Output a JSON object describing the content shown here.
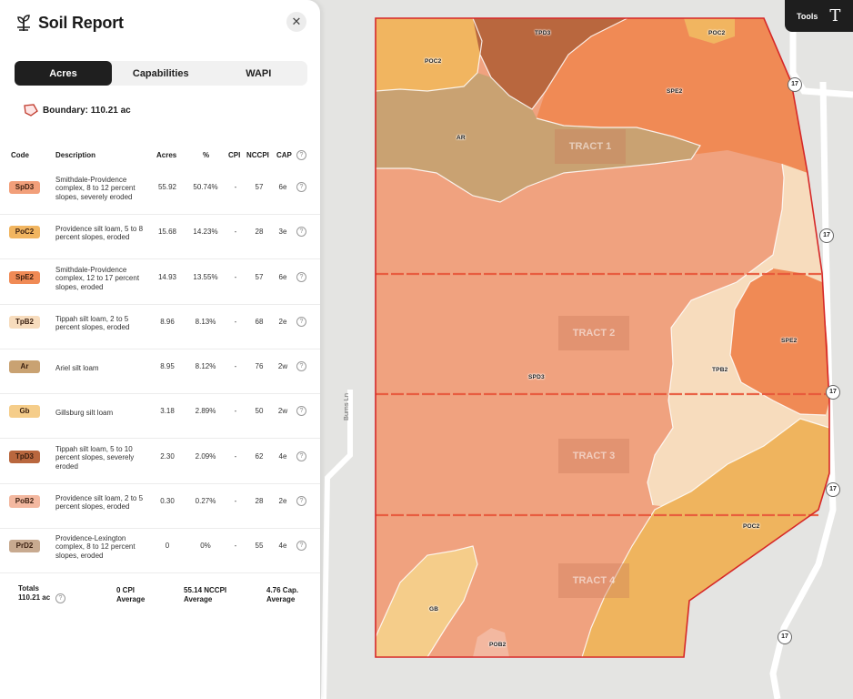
{
  "panel": {
    "title": "Soil Report",
    "close_icon": "close-icon",
    "tabs": [
      {
        "label": "Acres",
        "active": true
      },
      {
        "label": "Capabilities",
        "active": false
      },
      {
        "label": "WAPI",
        "active": false
      }
    ],
    "boundary_label": "Boundary: 110.21 ac"
  },
  "table": {
    "headers": {
      "code": "Code",
      "description": "Description",
      "acres": "Acres",
      "pct": "%",
      "cpi": "CPI",
      "nccpi": "NCCPI",
      "cap": "CAP"
    },
    "rows": [
      {
        "code": "SpD3",
        "color": "#f29f7a",
        "description": "Smithdale-Providence complex, 8 to 12 percent slopes, severely eroded",
        "acres": "55.92",
        "pct": "50.74%",
        "cpi": "-",
        "nccpi": "57",
        "cap": "6e"
      },
      {
        "code": "PoC2",
        "color": "#f1b560",
        "description": "Providence silt loam, 5 to 8 percent slopes, eroded",
        "acres": "15.68",
        "pct": "14.23%",
        "cpi": "-",
        "nccpi": "28",
        "cap": "3e"
      },
      {
        "code": "SpE2",
        "color": "#f08a55",
        "description": "Smithdale-Providence complex, 12 to 17 percent slopes, eroded",
        "acres": "14.93",
        "pct": "13.55%",
        "cpi": "-",
        "nccpi": "57",
        "cap": "6e"
      },
      {
        "code": "TpB2",
        "color": "#f7dcbd",
        "description": "Tippah silt loam, 2 to 5 percent slopes, eroded",
        "acres": "8.96",
        "pct": "8.13%",
        "cpi": "-",
        "nccpi": "68",
        "cap": "2e"
      },
      {
        "code": "Ar",
        "color": "#c9a272",
        "description": "Ariel silt loam",
        "acres": "8.95",
        "pct": "8.12%",
        "cpi": "-",
        "nccpi": "76",
        "cap": "2w"
      },
      {
        "code": "Gb",
        "color": "#f5cd8a",
        "description": "Gillsburg silt loam",
        "acres": "3.18",
        "pct": "2.89%",
        "cpi": "-",
        "nccpi": "50",
        "cap": "2w"
      },
      {
        "code": "TpD3",
        "color": "#b9673e",
        "description": "Tippah silt loam, 5 to 10 percent slopes, severely eroded",
        "acres": "2.30",
        "pct": "2.09%",
        "cpi": "-",
        "nccpi": "62",
        "cap": "4e"
      },
      {
        "code": "PoB2",
        "color": "#f3b8a0",
        "description": "Providence silt loam, 2 to 5 percent slopes, eroded",
        "acres": "0.30",
        "pct": "0.27%",
        "cpi": "-",
        "nccpi": "28",
        "cap": "2e"
      },
      {
        "code": "PrD2",
        "color": "#c8aa90",
        "description": "Providence-Lexington complex, 8 to 12 percent slopes, eroded",
        "acres": "0",
        "pct": "0%",
        "cpi": "-",
        "nccpi": "55",
        "cap": "4e"
      }
    ],
    "totals": {
      "label": "Totals",
      "acres": "110.21 ac",
      "cpi": "0 CPI",
      "cpi_sub": "Average",
      "nccpi": "55.14 NCCPI",
      "nccpi_sub": "Average",
      "cap": "4.76 Cap.",
      "cap_sub": "Average"
    }
  },
  "map": {
    "street_name": "Burns Ln",
    "road_number": "17",
    "tracts": [
      "TRACT 1",
      "TRACT 2",
      "TRACT 3",
      "TRACT 4"
    ],
    "soil_labels": [
      "TPD3",
      "POC2",
      "POC2",
      "SPE2",
      "AR",
      "SPE2",
      "TPB2",
      "SPD3",
      "POC2",
      "GB",
      "POB2"
    ],
    "boundary_color": "#d62828"
  },
  "toolbar": {
    "label": "Tools",
    "text_tool": "T"
  }
}
